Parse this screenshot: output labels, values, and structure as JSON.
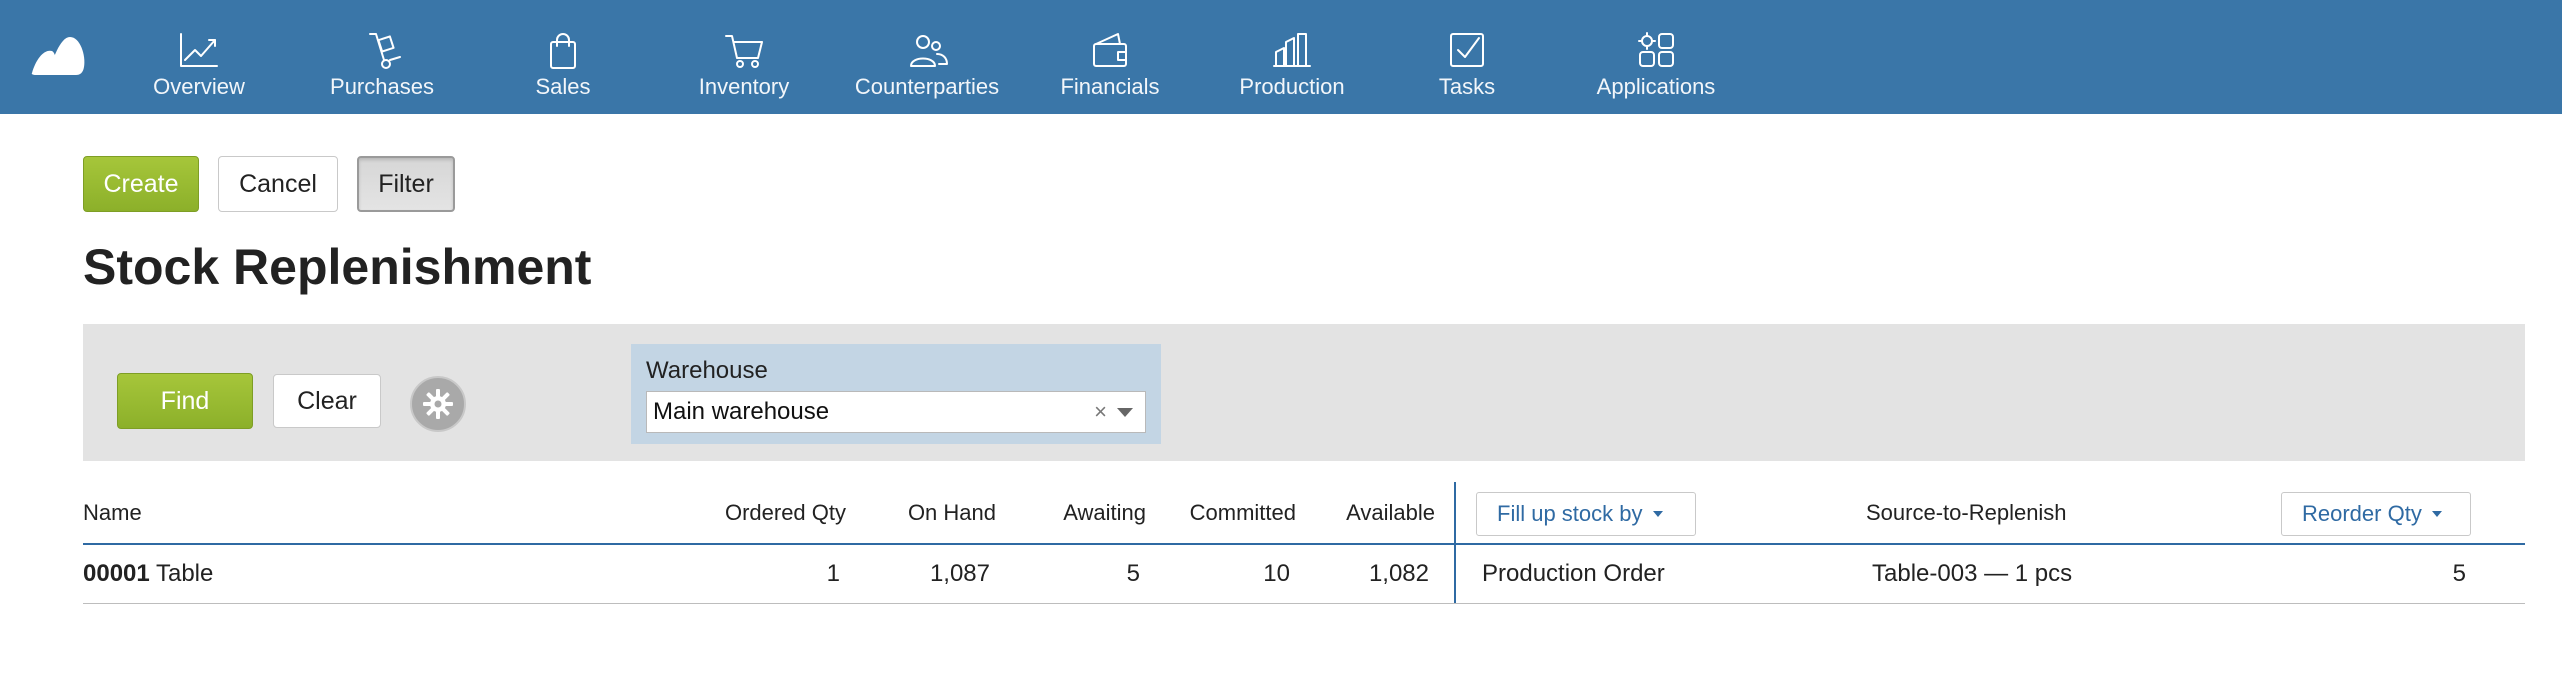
{
  "nav": {
    "items": [
      {
        "label": "Overview",
        "icon": "chart-line-icon"
      },
      {
        "label": "Purchases",
        "icon": "hand-truck-icon"
      },
      {
        "label": "Sales",
        "icon": "shopping-bag-icon"
      },
      {
        "label": "Inventory",
        "icon": "shopping-cart-icon"
      },
      {
        "label": "Counterparties",
        "icon": "people-icon"
      },
      {
        "label": "Financials",
        "icon": "wallet-icon"
      },
      {
        "label": "Production",
        "icon": "factory-icon"
      },
      {
        "label": "Tasks",
        "icon": "checkbox-icon"
      },
      {
        "label": "Applications",
        "icon": "apps-gear-icon"
      }
    ]
  },
  "toolbar": {
    "create_label": "Create",
    "cancel_label": "Cancel",
    "filter_label": "Filter"
  },
  "page": {
    "title": "Stock Replenishment"
  },
  "filter": {
    "find_label": "Find",
    "clear_label": "Clear",
    "warehouse_label": "Warehouse",
    "warehouse_value": "Main warehouse",
    "clear_icon": "×"
  },
  "table": {
    "headers": {
      "name": "Name",
      "ordered_qty": "Ordered Qty",
      "on_hand": "On Hand",
      "awaiting": "Awaiting",
      "committed": "Committed",
      "available": "Available",
      "fill_up": "Fill up stock by",
      "source": "Source-to-Replenish",
      "reorder_qty": "Reorder Qty"
    },
    "rows": [
      {
        "code": "00001",
        "name": "Table",
        "ordered_qty": "1",
        "on_hand": "1,087",
        "awaiting": "5",
        "committed": "10",
        "available": "1,082",
        "fill_up": "Production Order",
        "source": "Table-003 — 1 pcs",
        "reorder_qty": "5"
      }
    ]
  },
  "colors": {
    "topbar": "#3a76a8",
    "accent_green": "#97b930",
    "link_blue": "#2f6aa3",
    "filter_panel": "#e3e3e3",
    "warehouse_box": "#c3d5e4"
  }
}
